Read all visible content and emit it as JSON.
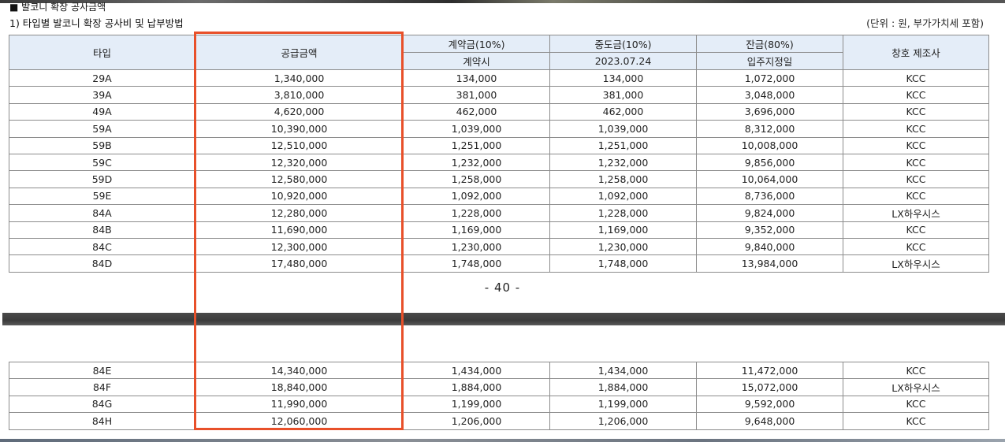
{
  "section_title": "■ 발코니 확장 공사금액",
  "subtitle": "1) 타입별 발코니 확장 공사비 및 납부방법",
  "unit_note": "(단위 : 원, 부가가치세 포함)",
  "headers": {
    "type": "타입",
    "supply": "공급금액",
    "contract_group": "계약금(10%)",
    "contract_when": "계약시",
    "middle_group": "중도금(10%)",
    "middle_when": "2023.07.24",
    "balance_group": "잔금(80%)",
    "balance_when": "입주지정일",
    "maker": "창호 제조사"
  },
  "rows_page1": [
    [
      "29A",
      "1,340,000",
      "134,000",
      "134,000",
      "1,072,000",
      "KCC"
    ],
    [
      "39A",
      "3,810,000",
      "381,000",
      "381,000",
      "3,048,000",
      "KCC"
    ],
    [
      "49A",
      "4,620,000",
      "462,000",
      "462,000",
      "3,696,000",
      "KCC"
    ],
    [
      "59A",
      "10,390,000",
      "1,039,000",
      "1,039,000",
      "8,312,000",
      "KCC"
    ],
    [
      "59B",
      "12,510,000",
      "1,251,000",
      "1,251,000",
      "10,008,000",
      "KCC"
    ],
    [
      "59C",
      "12,320,000",
      "1,232,000",
      "1,232,000",
      "9,856,000",
      "KCC"
    ],
    [
      "59D",
      "12,580,000",
      "1,258,000",
      "1,258,000",
      "10,064,000",
      "KCC"
    ],
    [
      "59E",
      "10,920,000",
      "1,092,000",
      "1,092,000",
      "8,736,000",
      "KCC"
    ],
    [
      "84A",
      "12,280,000",
      "1,228,000",
      "1,228,000",
      "9,824,000",
      "LX하우시스"
    ],
    [
      "84B",
      "11,690,000",
      "1,169,000",
      "1,169,000",
      "9,352,000",
      "KCC"
    ],
    [
      "84C",
      "12,300,000",
      "1,230,000",
      "1,230,000",
      "9,840,000",
      "KCC"
    ],
    [
      "84D",
      "17,480,000",
      "1,748,000",
      "1,748,000",
      "13,984,000",
      "LX하우시스"
    ]
  ],
  "page_number": "- 40 -",
  "rows_page2": [
    [
      "84E",
      "14,340,000",
      "1,434,000",
      "1,434,000",
      "11,472,000",
      "KCC"
    ],
    [
      "84F",
      "18,840,000",
      "1,884,000",
      "1,884,000",
      "15,072,000",
      "LX하우시스"
    ],
    [
      "84G",
      "11,990,000",
      "1,199,000",
      "1,199,000",
      "9,592,000",
      "KCC"
    ],
    [
      "84H",
      "12,060,000",
      "1,206,000",
      "1,206,000",
      "9,648,000",
      "KCC"
    ]
  ],
  "colors": {
    "header_bg": "#e4edf8",
    "highlight": "#e8502a",
    "border": "#8c8c8c"
  }
}
